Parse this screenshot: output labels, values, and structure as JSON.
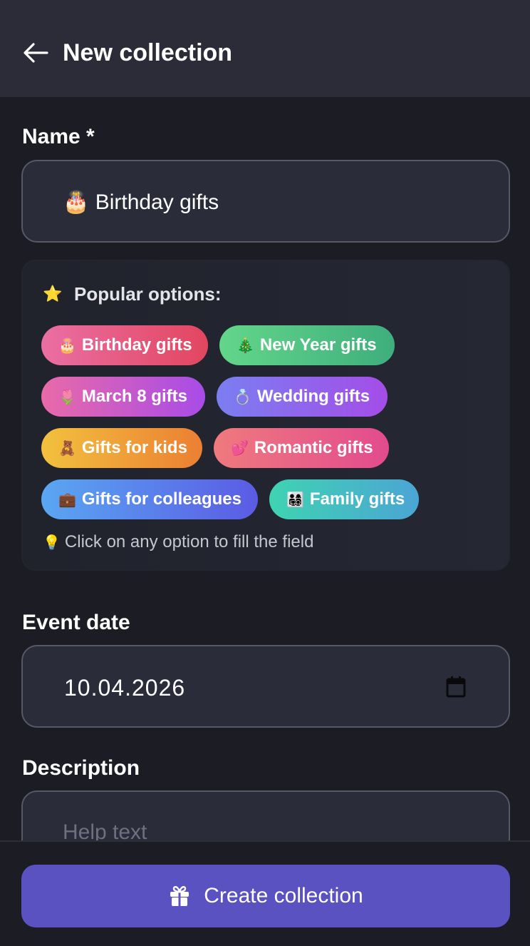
{
  "header": {
    "title": "New collection",
    "back_icon": "arrow-left-icon"
  },
  "name_field": {
    "label": "Name *",
    "value": "🎂 Birthday gifts"
  },
  "popular": {
    "icon": "star-icon",
    "star": "⭐",
    "title": "Popular options:",
    "chips": [
      {
        "emoji": "🎂",
        "label": "Birthday gifts",
        "color_from": "#ea6fa4",
        "color_to": "#e2465f"
      },
      {
        "emoji": "🎄",
        "label": "New Year gifts",
        "color_from": "#63d68a",
        "color_to": "#3fae7d"
      },
      {
        "emoji": "🌷",
        "label": "March 8 gifts",
        "color_from": "#e96aa8",
        "color_to": "#a84ce8"
      },
      {
        "emoji": "💍",
        "label": "Wedding gifts",
        "color_from": "#7b7ef0",
        "color_to": "#a44de8"
      },
      {
        "emoji": "🧸",
        "label": "Gifts for kids",
        "color_from": "#f2c13e",
        "color_to": "#ec7f33"
      },
      {
        "emoji": "💕",
        "label": "Romantic gifts",
        "color_from": "#ef7a7e",
        "color_to": "#e24b8e"
      },
      {
        "emoji": "💼",
        "label": "Gifts for colleagues",
        "color_from": "#5aa7f2",
        "color_to": "#5b5be4"
      },
      {
        "emoji": "👨‍👩‍👧‍👦",
        "label": "Family gifts",
        "color_from": "#3fd3b2",
        "color_to": "#4ba5d4"
      }
    ],
    "hint_emoji": "💡",
    "hint": "Click on any option to fill the field"
  },
  "date_field": {
    "label": "Event date",
    "value": "10.04.2026",
    "icon": "calendar-icon"
  },
  "description_field": {
    "label": "Description",
    "placeholder": "Help text"
  },
  "footer": {
    "button_label": "Create collection",
    "button_icon": "gift-icon",
    "button_color": "#5b52c2"
  }
}
